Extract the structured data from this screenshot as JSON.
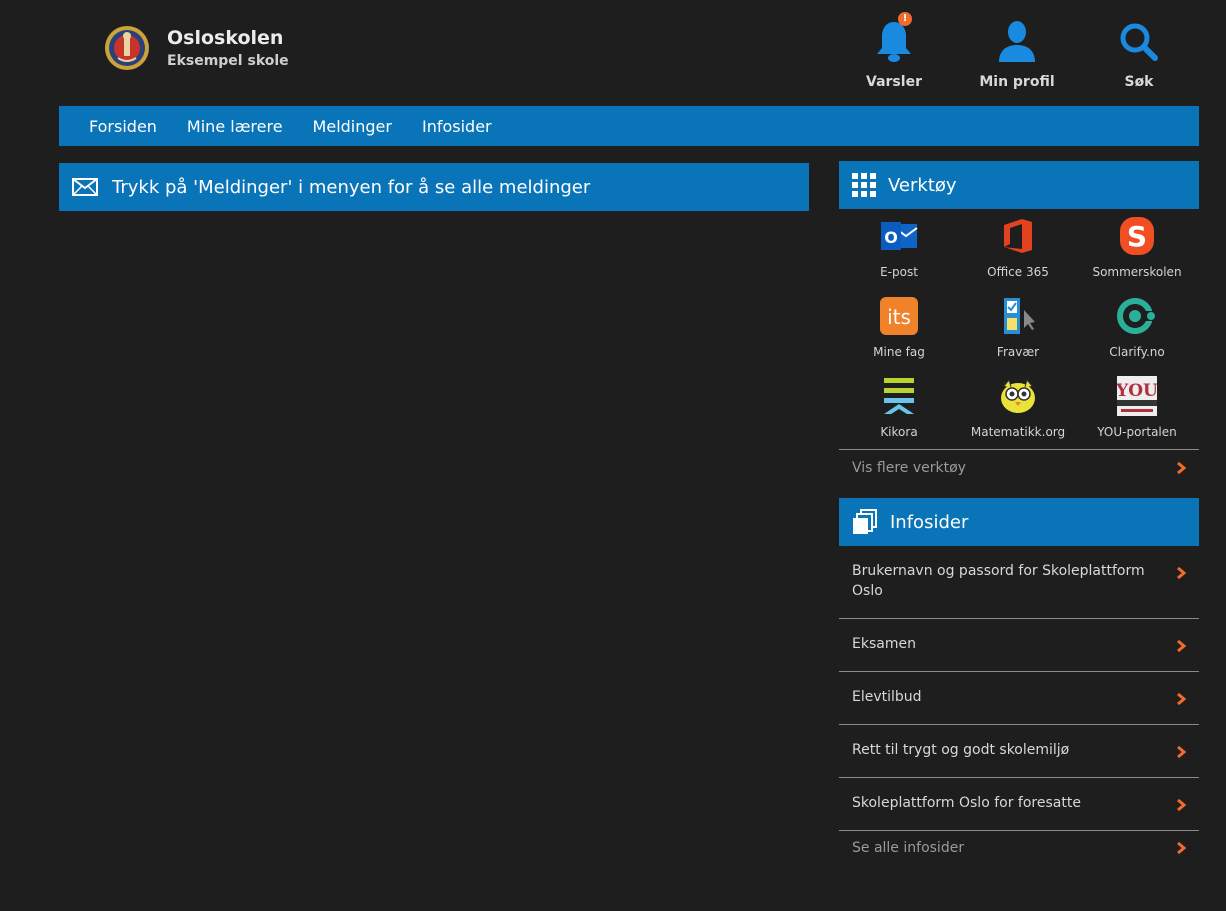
{
  "header": {
    "title": "Osloskolen",
    "subtitle": "Eksempel skole",
    "actions": [
      {
        "label": "Varsler",
        "icon": "bell-icon",
        "badge": "!"
      },
      {
        "label": "Min profil",
        "icon": "user-icon"
      },
      {
        "label": "Søk",
        "icon": "search-icon"
      }
    ]
  },
  "nav": {
    "items": [
      "Forsiden",
      "Mine lærere",
      "Meldinger",
      "Infosider"
    ]
  },
  "message": {
    "text": "Trykk på 'Meldinger' i menyen for å se alle meldinger",
    "icon": "envelope-icon"
  },
  "tools": {
    "title": "Verktøy",
    "icon": "grid-icon",
    "items": [
      {
        "label": "E-post",
        "icon": "outlook-icon"
      },
      {
        "label": "Office 365",
        "icon": "office-icon"
      },
      {
        "label": "Sommerskolen",
        "icon": "sommerskolen-icon"
      },
      {
        "label": "Mine fag",
        "icon": "its-icon"
      },
      {
        "label": "Fravær",
        "icon": "fravaer-icon"
      },
      {
        "label": "Clarify.no",
        "icon": "clarify-icon"
      },
      {
        "label": "Kikora",
        "icon": "kikora-icon"
      },
      {
        "label": "Matematikk.org",
        "icon": "owl-icon"
      },
      {
        "label": "YOU-portalen",
        "icon": "you-icon"
      }
    ],
    "more": "Vis flere verktøy"
  },
  "infosider": {
    "title": "Infosider",
    "icon": "pages-icon",
    "items": [
      "Brukernavn og passord for Skoleplattform Oslo",
      "Eksamen",
      "Elevtilbud",
      "Rett til trygt og godt skolemiljø",
      "Skoleplattform Oslo for foresatte"
    ],
    "more": "Se alle infosider"
  },
  "colors": {
    "background": "#1e1e1e",
    "accent": "#0a74b8",
    "chevron": "#ef6c2c",
    "badge": "#ef6c2c"
  }
}
